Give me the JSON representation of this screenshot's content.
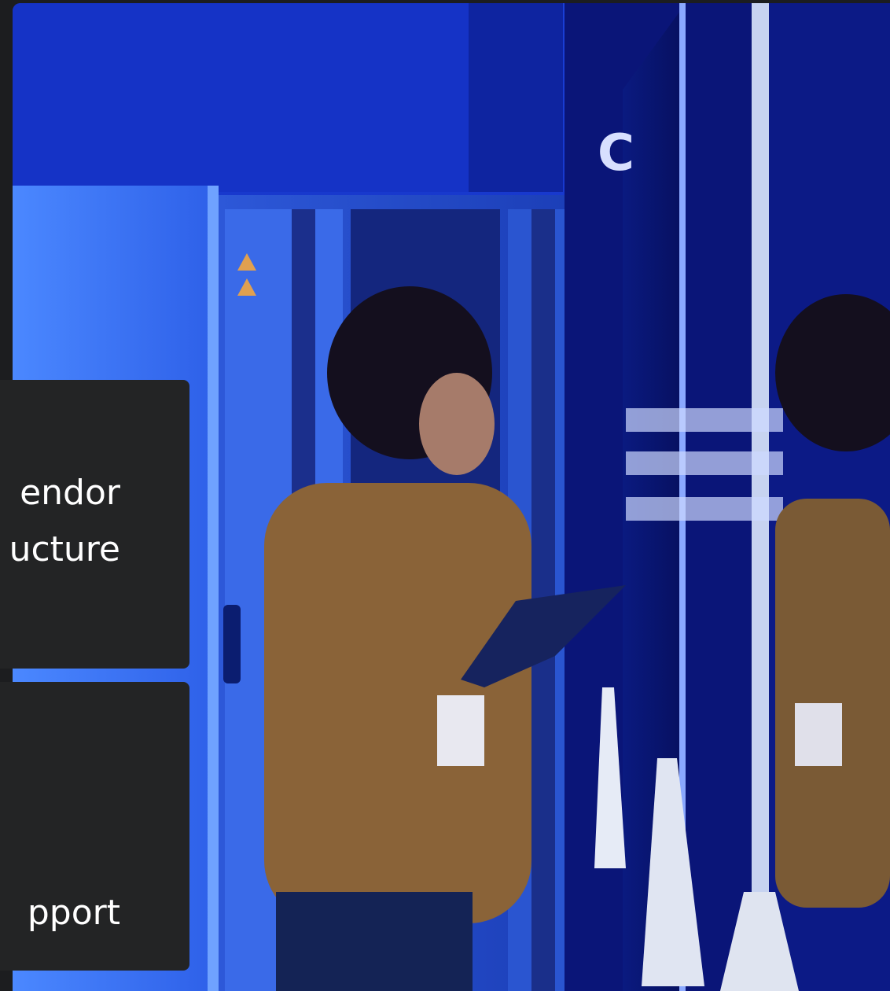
{
  "cards": [
    {
      "lines": [
        "endor",
        "ucture"
      ]
    },
    {
      "lines": [
        "pport"
      ]
    }
  ]
}
